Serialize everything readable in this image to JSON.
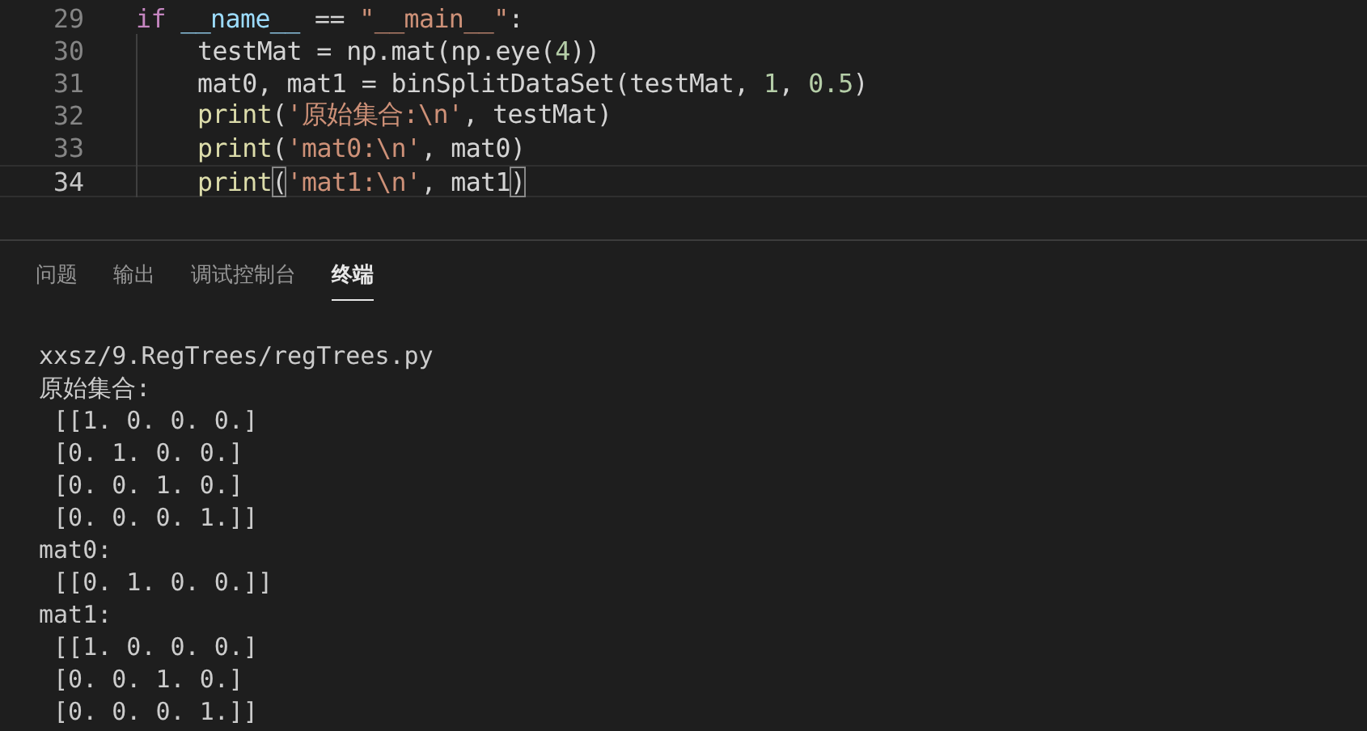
{
  "editor": {
    "lines": [
      {
        "number": "29",
        "current": false,
        "indented": false,
        "tokens": [
          {
            "text": "if ",
            "kind": "keyword"
          },
          {
            "text": "__name__",
            "kind": "variable"
          },
          {
            "text": " == ",
            "kind": "plain"
          },
          {
            "text": "\"__main__\"",
            "kind": "string"
          },
          {
            "text": ":",
            "kind": "plain"
          }
        ]
      },
      {
        "number": "30",
        "current": false,
        "indented": true,
        "tokens": [
          {
            "text": "testMat = np.mat(np.eye(",
            "kind": "plain"
          },
          {
            "text": "4",
            "kind": "number"
          },
          {
            "text": "))",
            "kind": "plain"
          }
        ]
      },
      {
        "number": "31",
        "current": false,
        "indented": true,
        "tokens": [
          {
            "text": "mat0, mat1 = binSplitDataSet(testMat, ",
            "kind": "plain"
          },
          {
            "text": "1",
            "kind": "number"
          },
          {
            "text": ", ",
            "kind": "plain"
          },
          {
            "text": "0.5",
            "kind": "number"
          },
          {
            "text": ")",
            "kind": "plain"
          }
        ]
      },
      {
        "number": "32",
        "current": false,
        "indented": true,
        "tokens": [
          {
            "text": "print",
            "kind": "function"
          },
          {
            "text": "(",
            "kind": "plain"
          },
          {
            "text": "'原始集合:\\n'",
            "kind": "string"
          },
          {
            "text": ", testMat)",
            "kind": "plain"
          }
        ]
      },
      {
        "number": "33",
        "current": false,
        "indented": true,
        "tokens": [
          {
            "text": "print",
            "kind": "function"
          },
          {
            "text": "(",
            "kind": "plain"
          },
          {
            "text": "'mat0:\\n'",
            "kind": "string"
          },
          {
            "text": ", mat0)",
            "kind": "plain"
          }
        ]
      },
      {
        "number": "34",
        "current": true,
        "indented": true,
        "tokens": [
          {
            "text": "print",
            "kind": "function"
          },
          {
            "text": "(",
            "kind": "bracket_match"
          },
          {
            "text": "'mat1:\\n'",
            "kind": "string"
          },
          {
            "text": ", mat1",
            "kind": "plain"
          },
          {
            "text": ")",
            "kind": "bracket_match"
          }
        ]
      }
    ]
  },
  "panel": {
    "tabs": [
      {
        "label": "问题",
        "selected": false
      },
      {
        "label": "输出",
        "selected": false
      },
      {
        "label": "调试控制台",
        "selected": false
      },
      {
        "label": "终端",
        "selected": true
      }
    ],
    "terminal_lines": [
      "xxsz/9.RegTrees/regTrees.py",
      "原始集合:",
      " [[1. 0. 0. 0.]",
      " [0. 1. 0. 0.]",
      " [0. 0. 1. 0.]",
      " [0. 0. 0. 1.]]",
      "mat0:",
      " [[0. 1. 0. 0.]]",
      "mat1:",
      " [[1. 0. 0. 0.]",
      " [0. 0. 1. 0.]",
      " [0. 0. 0. 1.]]"
    ]
  }
}
